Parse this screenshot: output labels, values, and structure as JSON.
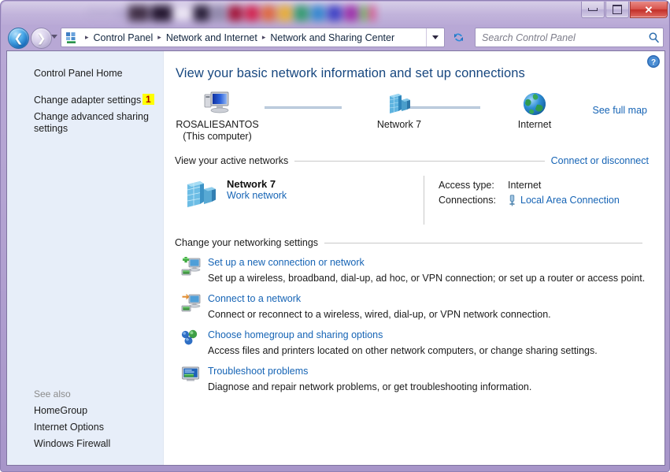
{
  "window": {
    "controls": {
      "minimize_label": "Minimize",
      "maximize_label": "Maximize",
      "close_label": "Close"
    },
    "blurred_toolbar_colors": [
      "#b9aed4",
      "#a59ac4",
      "#3b2a40",
      "#1d1028",
      "#efeaf6",
      "#241b33",
      "#8f87a9",
      "#a31236",
      "#d31f4a",
      "#e0663c",
      "#e8ad35",
      "#2f9a6e",
      "#2f86cf",
      "#3b3ec4",
      "#9c2fa8",
      "#6ab04c",
      "#d94f8a"
    ]
  },
  "nav": {
    "back_label": "Back",
    "forward_label": "Forward",
    "recent_pages_label": "Recent pages",
    "breadcrumbs": [
      "Control Panel",
      "Network and Internet",
      "Network and Sharing Center"
    ],
    "separator": "▸",
    "dropdown_label": "Previous locations",
    "refresh_label": "Refresh"
  },
  "search": {
    "placeholder": "Search Control Panel",
    "icon": "search-icon"
  },
  "sidebar": {
    "links": [
      {
        "label": "Control Panel Home",
        "badge": null
      },
      {
        "label": "Change adapter settings",
        "badge": "1"
      },
      {
        "label": "Change advanced sharing settings",
        "badge": null
      }
    ],
    "see_also_label": "See also",
    "see_also_links": [
      {
        "label": "HomeGroup"
      },
      {
        "label": "Internet Options"
      },
      {
        "label": "Windows Firewall"
      }
    ]
  },
  "content": {
    "help_label": "Help",
    "page_title": "View your basic network information and set up connections",
    "network_map": {
      "nodes": [
        {
          "icon": "computer-icon",
          "caption_line1": "ROSALIESANTOS",
          "caption_line2": "(This computer)"
        },
        {
          "icon": "network-icon",
          "caption_line1": "Network  7",
          "caption_line2": ""
        },
        {
          "icon": "internet-globe-icon",
          "caption_line1": "Internet",
          "caption_line2": ""
        }
      ],
      "see_full_map_label": "See full map"
    },
    "active_networks": {
      "heading": "View your active networks",
      "action_label": "Connect or disconnect",
      "network": {
        "name": "Network  7",
        "profile": "Work network",
        "access_type_label": "Access type:",
        "access_type_value": "Internet",
        "connections_label": "Connections:",
        "connections_value": "Local Area Connection"
      }
    },
    "networking_settings": {
      "heading": "Change your networking settings",
      "items": [
        {
          "icon": "new-connection-icon",
          "title": "Set up a new connection or network",
          "description": "Set up a wireless, broadband, dial-up, ad hoc, or VPN connection; or set up a router or access point."
        },
        {
          "icon": "connect-network-icon",
          "title": "Connect to a network",
          "description": "Connect or reconnect to a wireless, wired, dial-up, or VPN network connection."
        },
        {
          "icon": "homegroup-icon",
          "title": "Choose homegroup and sharing options",
          "description": "Access files and printers located on other network computers, or change sharing settings."
        },
        {
          "icon": "troubleshoot-icon",
          "title": "Troubleshoot problems",
          "description": "Diagnose and repair network problems, or get troubleshooting information."
        }
      ]
    }
  },
  "colors": {
    "accent_link": "#1664b5",
    "title_color": "#17477f",
    "badge_bg": "#ffff00",
    "badge_fg": "#aa0000",
    "sidebar_bg": "#e7eef9",
    "frame": "#b4a4d2"
  }
}
